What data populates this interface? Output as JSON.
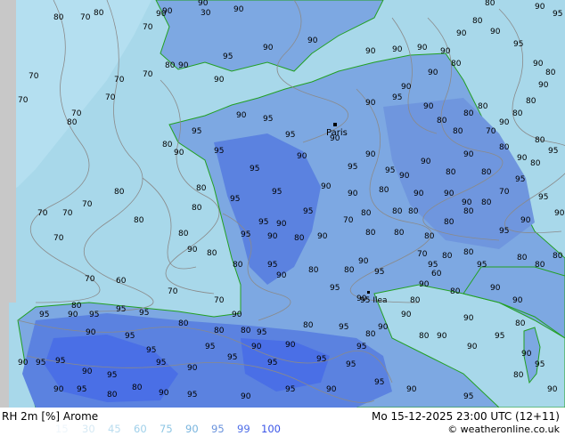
{
  "title": "RH 2m [%] Arome",
  "datetime": "Mo 15-12-2025 23:00 UTC (12+11)",
  "credit": "© weatheronline.co.uk",
  "legend": {
    "values": [
      "15",
      "30",
      "45",
      "60",
      "75",
      "90",
      "95",
      "99",
      "100"
    ],
    "colors": [
      "#eef6fb",
      "#d6e9f4",
      "#b9dcef",
      "#9fd0ea",
      "#8ec6e4",
      "#78b4de",
      "#6a93dc",
      "#4f6ee8",
      "#3a55e8"
    ]
  },
  "colors": {
    "sea": "#a8d8ea",
    "sea_outer": "#b4dff0",
    "land_high": "#7da8e2",
    "land_very_high": "#5b82e0",
    "land_saturated": "#4a6fe6",
    "no_data": "#c8c8c8",
    "coast": "#22a022",
    "contour": "#8a8a8a"
  },
  "city": "Paris",
  "place_label": "95 Ilea",
  "labels": [
    [
      "80",
      105,
      17
    ],
    [
      "90",
      182,
      15
    ],
    [
      "30",
      225,
      17
    ],
    [
      "90",
      262,
      13
    ],
    [
      "70",
      160,
      33
    ],
    [
      "90",
      175,
      18
    ],
    [
      "90",
      222,
      6
    ],
    [
      "80",
      60,
      22
    ],
    [
      "70",
      90,
      22
    ],
    [
      "90",
      345,
      48
    ],
    [
      "90",
      295,
      56
    ],
    [
      "95",
      250,
      66
    ],
    [
      "80",
      185,
      76
    ],
    [
      "90",
      200,
      76
    ],
    [
      "70",
      160,
      86
    ],
    [
      "90",
      240,
      92
    ],
    [
      "70",
      128,
      92
    ],
    [
      "70",
      118,
      112
    ],
    [
      "90",
      265,
      132
    ],
    [
      "95",
      295,
      136
    ],
    [
      "95",
      215,
      150
    ],
    [
      "80",
      182,
      165
    ],
    [
      "90",
      195,
      174
    ],
    [
      "95",
      240,
      172
    ],
    [
      "95",
      320,
      154
    ],
    [
      "90",
      333,
      178
    ],
    [
      "90",
      370,
      158
    ],
    [
      "95",
      280,
      192
    ],
    [
      "90",
      390,
      220
    ],
    [
      "95",
      258,
      226
    ],
    [
      "95",
      305,
      218
    ],
    [
      "90",
      360,
      212
    ],
    [
      "95",
      340,
      240
    ],
    [
      "95",
      290,
      252
    ],
    [
      "90",
      310,
      254
    ],
    [
      "90",
      300,
      268
    ],
    [
      "80",
      330,
      270
    ],
    [
      "90",
      356,
      268
    ],
    [
      "70",
      385,
      250
    ],
    [
      "80",
      405,
      242
    ],
    [
      "80",
      410,
      264
    ],
    [
      "95",
      270,
      266
    ],
    [
      "95",
      300,
      300
    ],
    [
      "90",
      310,
      312
    ],
    [
      "80",
      346,
      306
    ],
    [
      "80",
      386,
      306
    ],
    [
      "90",
      402,
      296
    ],
    [
      "95",
      420,
      308
    ],
    [
      "95",
      370,
      326
    ],
    [
      "90",
      400,
      338
    ],
    [
      "80",
      220,
      214
    ],
    [
      "80",
      215,
      236
    ],
    [
      "80",
      200,
      265
    ],
    [
      "90",
      210,
      283
    ],
    [
      "80",
      232,
      287
    ],
    [
      "80",
      261,
      300
    ],
    [
      "70",
      240,
      340
    ],
    [
      "70",
      188,
      330
    ],
    [
      "60",
      130,
      318
    ],
    [
      "70",
      95,
      316
    ],
    [
      "70",
      60,
      270
    ],
    [
      "70",
      42,
      242
    ],
    [
      "80",
      128,
      218
    ],
    [
      "80",
      150,
      250
    ],
    [
      "70",
      92,
      232
    ],
    [
      "70",
      70,
      242
    ],
    [
      "80",
      75,
      140
    ],
    [
      "70",
      80,
      130
    ],
    [
      "70",
      20,
      115
    ],
    [
      "70",
      32,
      88
    ],
    [
      "90",
      20,
      410
    ],
    [
      "95",
      40,
      410
    ],
    [
      "95",
      62,
      408
    ],
    [
      "90",
      92,
      420
    ],
    [
      "95",
      120,
      424
    ],
    [
      "95",
      175,
      410
    ],
    [
      "90",
      210,
      416
    ],
    [
      "95",
      230,
      392
    ],
    [
      "95",
      255,
      404
    ],
    [
      "90",
      282,
      392
    ],
    [
      "95",
      300,
      410
    ],
    [
      "90",
      320,
      390
    ],
    [
      "95",
      355,
      406
    ],
    [
      "95",
      388,
      412
    ],
    [
      "95",
      400,
      392
    ],
    [
      "80",
      410,
      378
    ],
    [
      "90",
      424,
      370
    ],
    [
      "90",
      450,
      356
    ],
    [
      "80",
      460,
      340
    ],
    [
      "90",
      470,
      322
    ],
    [
      "95",
      480,
      300
    ],
    [
      "80",
      496,
      290
    ],
    [
      "80",
      520,
      286
    ],
    [
      "95",
      535,
      300
    ],
    [
      "90",
      550,
      326
    ],
    [
      "90",
      575,
      340
    ],
    [
      "80",
      505,
      330
    ],
    [
      "90",
      520,
      360
    ],
    [
      "90",
      490,
      380
    ],
    [
      "80",
      470,
      380
    ],
    [
      "90",
      524,
      392
    ],
    [
      "95",
      555,
      380
    ],
    [
      "80",
      578,
      366
    ],
    [
      "90",
      585,
      400
    ],
    [
      "95",
      600,
      412
    ],
    [
      "90",
      410,
      60
    ],
    [
      "90",
      440,
      58
    ],
    [
      "90",
      468,
      56
    ],
    [
      "90",
      494,
      60
    ],
    [
      "80",
      506,
      74
    ],
    [
      "90",
      480,
      84
    ],
    [
      "90",
      450,
      100
    ],
    [
      "90",
      410,
      118
    ],
    [
      "95",
      440,
      112
    ],
    [
      "90",
      475,
      122
    ],
    [
      "80",
      490,
      138
    ],
    [
      "80",
      508,
      150
    ],
    [
      "80",
      520,
      130
    ],
    [
      "80",
      536,
      122
    ],
    [
      "70",
      545,
      150
    ],
    [
      "90",
      560,
      140
    ],
    [
      "80",
      575,
      130
    ],
    [
      "80",
      590,
      116
    ],
    [
      "90",
      604,
      98
    ],
    [
      "80",
      612,
      84
    ],
    [
      "90",
      598,
      74
    ],
    [
      "95",
      576,
      52
    ],
    [
      "90",
      550,
      38
    ],
    [
      "80",
      530,
      26
    ],
    [
      "90",
      512,
      40
    ],
    [
      "80",
      544,
      6
    ],
    [
      "90",
      600,
      10
    ],
    [
      "95",
      620,
      18
    ],
    [
      "80",
      600,
      160
    ],
    [
      "95",
      615,
      172
    ],
    [
      "80",
      595,
      186
    ],
    [
      "95",
      578,
      204
    ],
    [
      "70",
      560,
      218
    ],
    [
      "80",
      540,
      230
    ],
    [
      "80",
      520,
      240
    ],
    [
      "80",
      498,
      252
    ],
    [
      "80",
      476,
      268
    ],
    [
      "70",
      468,
      288
    ],
    [
      "60",
      484,
      310
    ],
    [
      "80",
      440,
      240
    ],
    [
      "80",
      442,
      264
    ],
    [
      "90",
      464,
      220
    ],
    [
      "90",
      448,
      200
    ],
    [
      "80",
      425,
      216
    ],
    [
      "95",
      432,
      194
    ],
    [
      "90",
      410,
      176
    ],
    [
      "95",
      390,
      190
    ],
    [
      "90",
      472,
      184
    ],
    [
      "80",
      500,
      196
    ],
    [
      "90",
      520,
      176
    ],
    [
      "80",
      540,
      196
    ],
    [
      "80",
      560,
      168
    ],
    [
      "90",
      580,
      180
    ],
    [
      "95",
      604,
      224
    ],
    [
      "90",
      622,
      242
    ],
    [
      "80",
      620,
      290
    ],
    [
      "80",
      600,
      300
    ],
    [
      "80",
      580,
      292
    ],
    [
      "95",
      560,
      262
    ],
    [
      "90",
      584,
      250
    ],
    [
      "90",
      518,
      230
    ],
    [
      "90",
      498,
      220
    ],
    [
      "80",
      458,
      240
    ],
    [
      "95",
      44,
      356
    ],
    [
      "80",
      80,
      346
    ],
    [
      "90",
      76,
      356
    ],
    [
      "95",
      100,
      356
    ],
    [
      "95",
      130,
      350
    ],
    [
      "95",
      156,
      354
    ],
    [
      "90",
      96,
      376
    ],
    [
      "95",
      140,
      380
    ],
    [
      "95",
      164,
      396
    ],
    [
      "80",
      200,
      366
    ],
    [
      "90",
      260,
      356
    ],
    [
      "80",
      270,
      374
    ],
    [
      "95",
      288,
      376
    ],
    [
      "80",
      340,
      368
    ],
    [
      "95",
      380,
      370
    ],
    [
      "80",
      240,
      374
    ],
    [
      "80",
      148,
      438
    ],
    [
      "90",
      178,
      444
    ],
    [
      "95",
      210,
      446
    ],
    [
      "90",
      270,
      448
    ],
    [
      "95",
      320,
      440
    ],
    [
      "90",
      366,
      440
    ],
    [
      "95",
      420,
      432
    ],
    [
      "90",
      456,
      440
    ],
    [
      "95",
      520,
      448
    ],
    [
      "80",
      576,
      424
    ],
    [
      "90",
      614,
      440
    ],
    [
      "90",
      60,
      440
    ],
    [
      "95",
      86,
      440
    ],
    [
      "80",
      120,
      446
    ]
  ]
}
